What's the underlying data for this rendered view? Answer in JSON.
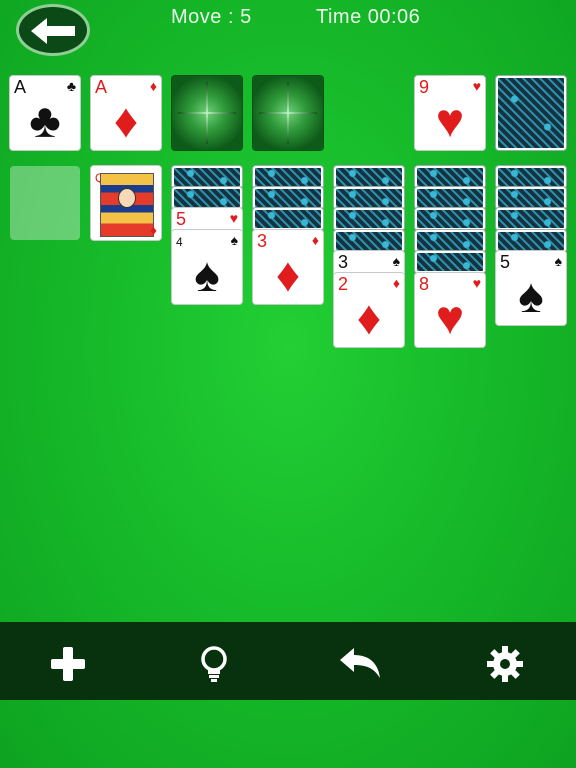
{
  "hud": {
    "move_label": "Move : 5",
    "time_label": "Time 00:06"
  },
  "colors": {
    "felt": "#17bb2a",
    "toolbar": "#07320d",
    "red_suit": "#e01c1c",
    "black_suit": "#111111"
  },
  "icons": {
    "back": "left-arrow-icon",
    "new_game": "plus-icon",
    "hint": "lightbulb-icon",
    "undo": "undo-arrow-icon",
    "settings": "gear-icon"
  },
  "foundations": [
    {
      "rank": "A",
      "suit": "♣"
    },
    {
      "rank": "A",
      "suit": "♦"
    },
    {
      "rank": "",
      "suit": ""
    },
    {
      "rank": "",
      "suit": ""
    }
  ],
  "waste": {
    "rank": "9",
    "suit": "♥"
  },
  "stock": {
    "face_down": true
  },
  "tableau": [
    {
      "face_down": 0,
      "face_up": []
    },
    {
      "face_down": 0,
      "face_up": [
        {
          "rank": "Q",
          "suit": "♦"
        }
      ]
    },
    {
      "face_down": 2,
      "face_up": [
        {
          "rank": "5",
          "suit": "♥"
        },
        {
          "rank": "4",
          "suit": "♠"
        }
      ]
    },
    {
      "face_down": 3,
      "face_up": [
        {
          "rank": "3",
          "suit": "♦"
        }
      ]
    },
    {
      "face_down": 4,
      "face_up": [
        {
          "rank": "3",
          "suit": "♠"
        },
        {
          "rank": "2",
          "suit": "♦"
        }
      ]
    },
    {
      "face_down": 5,
      "face_up": [
        {
          "rank": "8",
          "suit": "♥"
        }
      ]
    },
    {
      "face_down": 4,
      "face_up": [
        {
          "rank": "5",
          "suit": "♠"
        }
      ]
    }
  ]
}
